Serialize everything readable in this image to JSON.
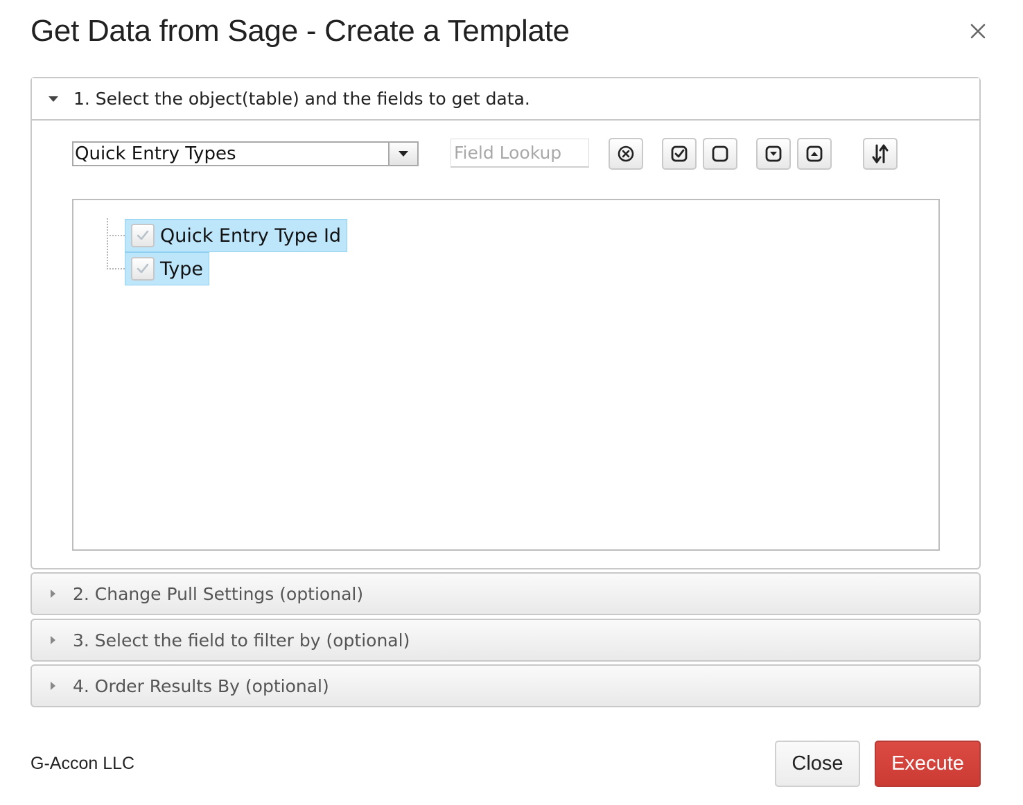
{
  "dialog": {
    "title": "Get Data from Sage - Create a Template",
    "close_icon": "close-icon"
  },
  "sections": [
    {
      "label": "1. Select the object(table) and the fields to get data.",
      "expanded": true
    },
    {
      "label": "2. Change Pull Settings (optional)",
      "expanded": false
    },
    {
      "label": "3. Select the field to filter by (optional)",
      "expanded": false
    },
    {
      "label": "4. Order Results By (optional)",
      "expanded": false
    }
  ],
  "object_select": {
    "value": "Quick Entry Types"
  },
  "field_lookup": {
    "placeholder": "Field Lookup",
    "value": ""
  },
  "toolbar": {
    "buttons": [
      {
        "name": "clear-lookup-button",
        "icon": "circle-x-icon"
      },
      {
        "name": "check-all-button",
        "icon": "checked-box-icon"
      },
      {
        "name": "uncheck-all-button",
        "icon": "empty-box-icon"
      },
      {
        "name": "expand-all-button",
        "icon": "box-arrow-down-icon"
      },
      {
        "name": "collapse-all-button",
        "icon": "box-arrow-up-icon"
      },
      {
        "name": "sort-button",
        "icon": "sort-arrows-icon"
      }
    ]
  },
  "fields": [
    {
      "label": "Quick Entry Type Id",
      "checked": true
    },
    {
      "label": "Type",
      "checked": true
    }
  ],
  "footer": {
    "brand": "G-Accon LLC",
    "close_label": "Close",
    "execute_label": "Execute"
  },
  "colors": {
    "execute": "#d2403a",
    "selected_node": "#bde6fb"
  }
}
